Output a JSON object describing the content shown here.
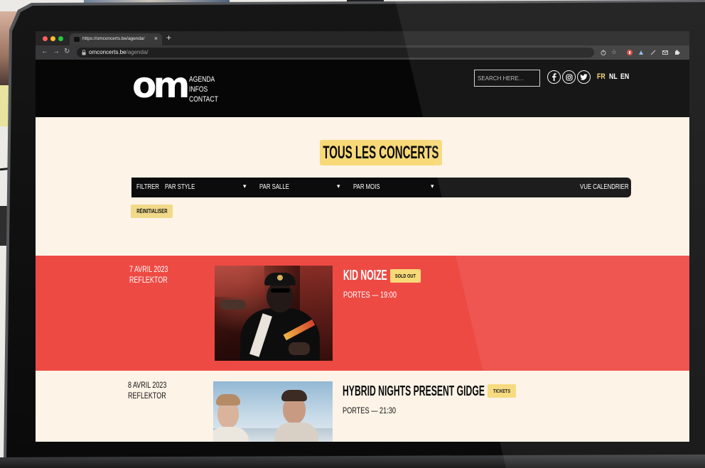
{
  "browser": {
    "tab": {
      "title": "https://omconcerts.be/agenda/",
      "close": "×"
    },
    "new_tab": "+",
    "url": {
      "host": "omconcerts.be",
      "path": "/agenda/"
    },
    "icons": [
      "back-icon",
      "forward-icon",
      "reload-icon",
      "lock-icon",
      "share-icon",
      "star-icon",
      "extension-icon",
      "puzzle-icon"
    ]
  },
  "site": {
    "logo": "om",
    "nav": [
      "AGENDA",
      "INFOS",
      "CONTACT"
    ],
    "search": {
      "placeholder": "SEARCH HERE..."
    },
    "social": [
      "facebook-icon",
      "instagram-icon",
      "twitter-icon"
    ],
    "languages": [
      {
        "label": "FR",
        "active": true
      },
      {
        "label": "NL",
        "active": false
      },
      {
        "label": "EN",
        "active": false
      }
    ]
  },
  "agenda": {
    "title": "TOUS LES CONCERTS",
    "filters": {
      "label": "FILTRER",
      "style": "PAR STYLE",
      "salle": "PAR SALLE",
      "mois": "PAR MOIS",
      "calendar": "VUE CALENDRIER"
    },
    "reset": "RÉINITIALISER"
  },
  "events": [
    {
      "date": "7 AVRIL 2023",
      "venue": "REFLEKTOR",
      "title": "KID NOIZE",
      "badge": "SOLD OUT",
      "doors": "PORTES — 19:00"
    },
    {
      "date": "8 AVRIL 2023",
      "venue": "REFLEKTOR",
      "title": "HYBRID NIGHTS PRESENT GIDGE",
      "badge": "TICKETS",
      "doors": "PORTES — 21:30"
    }
  ],
  "colors": {
    "accent_yellow": "#f7d977",
    "event_red": "#ee4a44",
    "cream": "#fdf3e6",
    "header_black": "#060606"
  }
}
